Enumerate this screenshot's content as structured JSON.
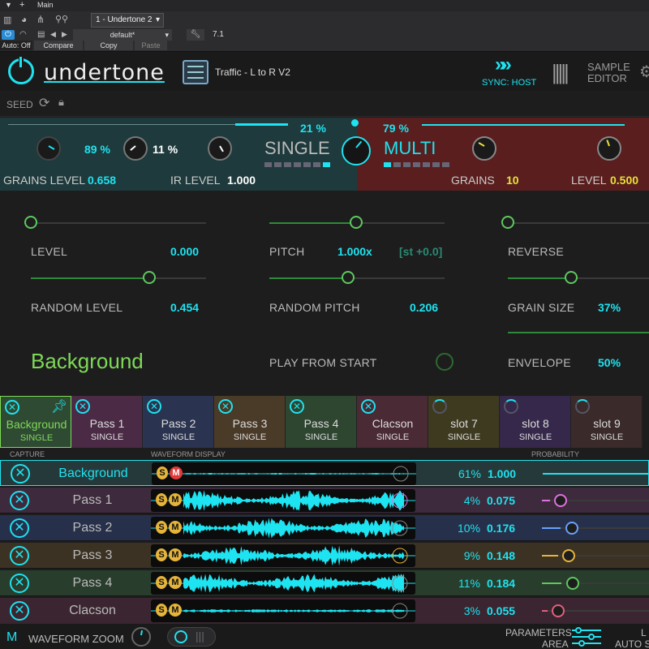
{
  "host": {
    "track_name": "Main",
    "instance": "1 - Undertone 2",
    "preset": "default*",
    "version": "7.1",
    "auto_off": "Auto: Off",
    "compare": "Compare",
    "copy": "Copy",
    "paste": "Paste"
  },
  "header": {
    "logo": "undertone",
    "preset_name": "Traffic - L to R V2",
    "sync": "SYNC: HOST",
    "sample_editor_1": "SAMPLE",
    "sample_editor_2": "EDITOR",
    "seed": "SEED"
  },
  "mix": {
    "single_pct": "21 %",
    "multi_pct": "79 %",
    "single_label": "SINGLE",
    "multi_label": "MULTI",
    "knob1_pct": "89 %",
    "knob2_pct": "11 %",
    "grains_level_label": "GRAINS LEVEL",
    "grains_level_value": "0.658",
    "ir_level_label": "IR LEVEL",
    "ir_level_value": "1.000",
    "grains_label": "GRAINS",
    "grains_value": "10",
    "level_label": "LEVEL",
    "level_value": "0.500"
  },
  "params": {
    "level_label": "LEVEL",
    "level_value": "0.000",
    "random_level_label": "RANDOM LEVEL",
    "random_level_value": "0.454",
    "pitch_label": "PITCH",
    "pitch_value": "1.000x",
    "pitch_st": "[st +0.0]",
    "random_pitch_label": "RANDOM PITCH",
    "random_pitch_value": "0.206",
    "reverse_label": "REVERSE",
    "grain_size_label": "GRAIN SIZE",
    "grain_size_value": "37%",
    "envelope_label": "ENVELOPE",
    "envelope_value": "50%",
    "play_from_start": "PLAY FROM START",
    "layer_name": "Background"
  },
  "tabs": [
    {
      "name": "Background",
      "mode": "SINGLE",
      "color": "#2f4a33"
    },
    {
      "name": "Pass 1",
      "mode": "SINGLE",
      "color": "#4a2a45"
    },
    {
      "name": "Pass 2",
      "mode": "SINGLE",
      "color": "#2a3450"
    },
    {
      "name": "Pass 3",
      "mode": "SINGLE",
      "color": "#4a3a28"
    },
    {
      "name": "Pass 4",
      "mode": "SINGLE",
      "color": "#2e4530"
    },
    {
      "name": "Clacson",
      "mode": "SINGLE",
      "color": "#4a2a34"
    },
    {
      "name": "slot 7",
      "mode": "SINGLE",
      "color": "#3e3a20"
    },
    {
      "name": "slot 8",
      "mode": "SINGLE",
      "color": "#35284a"
    },
    {
      "name": "slot 9",
      "mode": "SINGLE",
      "color": "#3a2a2a"
    }
  ],
  "columns": {
    "capture": "CAPTURE",
    "waveform": "WAVEFORM DISPLAY",
    "probability": "PROBABILITY"
  },
  "rows": [
    {
      "name": "Background",
      "pct": "61%",
      "prob": "1.000",
      "color": "#25393a",
      "knob": "#1ee3f0"
    },
    {
      "name": "Pass 1",
      "pct": "4%",
      "prob": "0.075",
      "color": "#3d2a3c",
      "knob": "#e070e0"
    },
    {
      "name": "Pass 2",
      "pct": "10%",
      "prob": "0.176",
      "color": "#27304a",
      "knob": "#6aa0ff"
    },
    {
      "name": "Pass 3",
      "pct": "9%",
      "prob": "0.148",
      "color": "#3c3224",
      "knob": "#e6b43a"
    },
    {
      "name": "Pass 4",
      "pct": "11%",
      "prob": "0.184",
      "color": "#283d2c",
      "knob": "#5ec85e"
    },
    {
      "name": "Clacson",
      "pct": "3%",
      "prob": "0.055",
      "color": "#3a2530",
      "knob": "#e06080"
    }
  ],
  "footer": {
    "m": "M",
    "waveform_zoom": "WAVEFORM ZOOM",
    "parameters_area_1": "PARAMETERS",
    "parameters_area_2": "AREA",
    "auto_s": "AUTO S",
    "l": "L"
  }
}
